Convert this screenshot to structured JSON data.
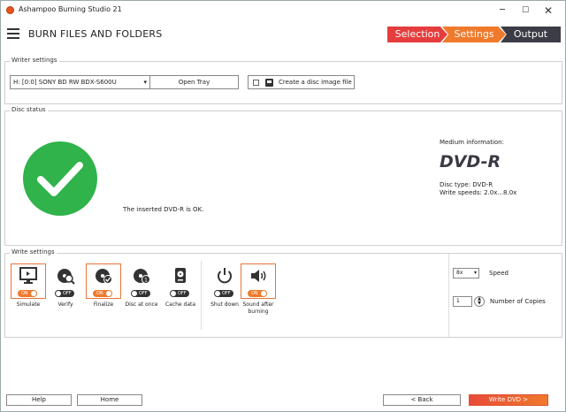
{
  "window": {
    "title": "Ashampoo Burning Studio 21",
    "min_glyph": "─",
    "max_glyph": "☐",
    "close_glyph": "✕"
  },
  "header": {
    "title": "BURN FILES AND FOLDERS",
    "steps": [
      "Selection",
      "Settings",
      "Output"
    ],
    "active_step": "Settings"
  },
  "writer": {
    "group_label": "Writer settings",
    "drive": "H: [0:0] SONY    BD RW BDX-S600U",
    "open_tray": "Open Tray",
    "image_option": "Create a disc image file",
    "image_checked": false
  },
  "disc": {
    "group_label": "Disc status",
    "status_message": "The inserted DVD-R is OK.",
    "medium_heading": "Medium information:",
    "medium_type": "DVD-R",
    "disc_type": "Disc type: DVD-R",
    "write_speeds": "Write speeds: 2.0x...8.0x"
  },
  "write": {
    "group_label": "Write settings",
    "options": [
      {
        "label": "Simulate",
        "state": "ON",
        "icon": "monitor-icon"
      },
      {
        "label": "Verify",
        "state": "OFF",
        "icon": "disc-search-icon"
      },
      {
        "label": "Finalize",
        "state": "ON",
        "icon": "disc-check-icon"
      },
      {
        "label": "Disc at once",
        "state": "OFF",
        "icon": "disc-one-icon"
      },
      {
        "label": "Cache data",
        "state": "OFF",
        "icon": "hard-drive-icon"
      },
      {
        "label": "Shut down",
        "state": "OFF",
        "icon": "power-icon"
      },
      {
        "label": "Sound after burning",
        "state": "ON",
        "icon": "speaker-icon"
      }
    ],
    "speed_value": "8x",
    "speed_label": "Speed",
    "copies_value": "1",
    "copies_label": "Number of Copies"
  },
  "footer": {
    "help": "Help",
    "home": "Home",
    "back": "< Back",
    "write": "Write DVD >"
  },
  "colors": {
    "ok_green": "#2fb34a",
    "accent_orange": "#f07a2c",
    "step_red": "#e53d3d",
    "step_dark": "#3c3c46"
  }
}
